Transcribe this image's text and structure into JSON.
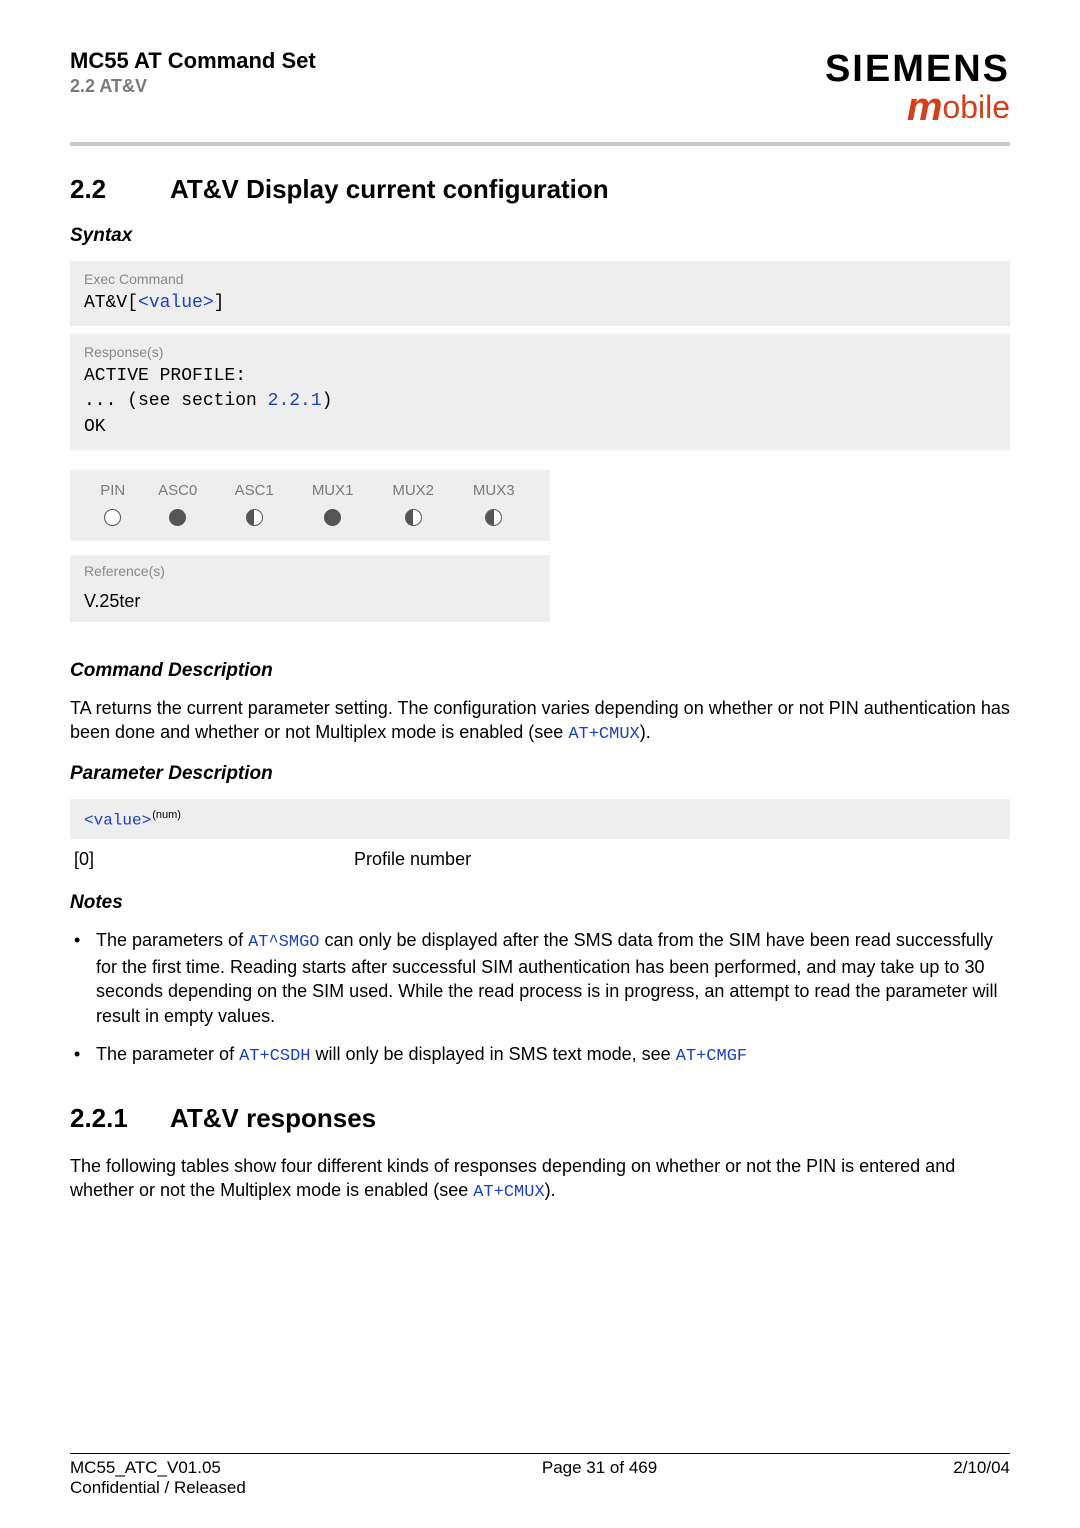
{
  "header": {
    "title": "MC55 AT Command Set",
    "subtitle": "2.2 AT&V",
    "brand_top": "SIEMENS",
    "brand_bottom_m": "m",
    "brand_bottom_rest": "obile"
  },
  "section": {
    "number": "2.2",
    "title": "AT&V   Display current configuration"
  },
  "syntax": {
    "heading": "Syntax",
    "exec_label": "Exec Command",
    "exec_prefix": "AT&V",
    "exec_open": "[",
    "exec_param": "<value>",
    "exec_close": "]",
    "resp_label": "Response(s)",
    "resp_line1": "ACTIVE PROFILE:",
    "resp_line2_pre": "... (see section ",
    "resp_line2_link": "2.2.1",
    "resp_line2_post": ")",
    "resp_line3": "OK"
  },
  "pin_table": {
    "headers": [
      "PIN",
      "ASC0",
      "ASC1",
      "MUX1",
      "MUX2",
      "MUX3"
    ],
    "states": [
      "empty",
      "full",
      "half",
      "full",
      "half",
      "half"
    ]
  },
  "reference": {
    "label": "Reference(s)",
    "value": "V.25ter"
  },
  "cmddesc": {
    "heading": "Command Description",
    "text_pre": "TA returns the current parameter setting. The configuration varies depending on whether or not PIN authentication has been done and whether or not Multiplex mode is enabled (see ",
    "text_link": "AT+CMUX",
    "text_post": ")."
  },
  "paramdesc": {
    "heading": "Parameter Description",
    "tag": "<value>",
    "sup": "(num)",
    "row_key": "[0]",
    "row_val": "Profile number"
  },
  "notes": {
    "heading": "Notes",
    "n1_pre": "The parameters of ",
    "n1_link": "AT^SMGO",
    "n1_post": " can only be displayed after the SMS data from the SIM have been read successfully for the first time. Reading starts after successful SIM authentication has been performed, and may take up to 30 seconds depending on the SIM used. While the read process is in progress, an attempt to read the parameter will result in empty values.",
    "n2_pre": "The parameter of ",
    "n2_link1": "AT+CSDH",
    "n2_mid": " will only be displayed in SMS text mode, see ",
    "n2_link2": "AT+CMGF"
  },
  "subsection": {
    "number": "2.2.1",
    "title": "AT&V responses",
    "body_pre": "The following tables show four different kinds of responses depending on whether or not the PIN is entered and whether or not the Multiplex mode is enabled (see ",
    "body_link": "AT+CMUX",
    "body_post": ")."
  },
  "footer": {
    "left1": "MC55_ATC_V01.05",
    "left2": "Confidential / Released",
    "center": "Page 31 of 469",
    "right": "2/10/04"
  }
}
